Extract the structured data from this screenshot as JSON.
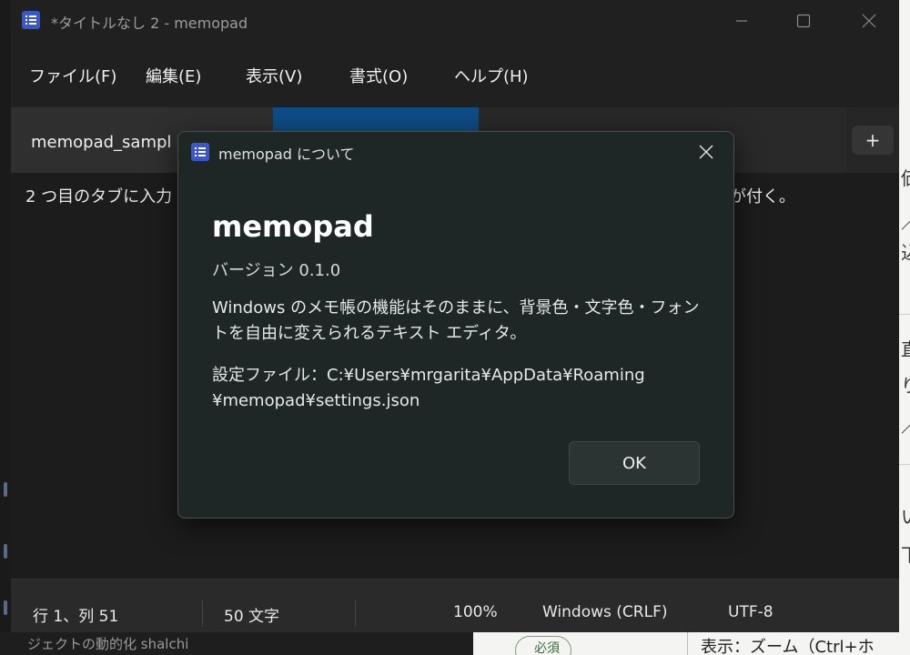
{
  "window": {
    "title": "*タイトルなし 2 - memopad"
  },
  "menu": {
    "file": "ファイル(F)",
    "edit": "編集(E)",
    "view": "表示(V)",
    "format": "書式(O)",
    "help": "ヘルプ(H)"
  },
  "tabs": {
    "active_label": "memopad_sampl",
    "add_label": "+"
  },
  "editor": {
    "text_start": "2 つ目のタブに入力",
    "text_end": "が付く。"
  },
  "status": {
    "position": "行 1、列 51",
    "chars": "50 文字",
    "zoom": "100%",
    "line_ending": "Windows (CRLF)",
    "encoding": "UTF-8"
  },
  "dialog": {
    "title": "memopad について",
    "app_name": "memopad",
    "version": "バージョン 0.1.0",
    "description": "Windows のメモ帳の機能はそのままに、背景色・文字色・フォントを自由に変えられるテキスト エディタ。",
    "settings_line1": "設定ファイル：C:¥Users¥mrgarita¥AppData¥Roaming",
    "settings_line2": "¥memopad¥settings.json",
    "ok_label": "OK"
  },
  "background": {
    "right_frag_1": "価",
    "right_frag_2": "／",
    "right_frag_3": "込",
    "right_frag_4": "直",
    "right_frag_5": "り",
    "right_frag_6": "／",
    "right_frag_7": "い",
    "right_frag_8": "下",
    "bottom_left": "ジェクトの動的化 shalchi",
    "bottom_pill": "必須",
    "bottom_text": "表示：ズーム（Ctrl+ホ"
  },
  "colors": {
    "accent_blue": "#1f6bb0",
    "dialog_bg": "#1f2626",
    "window_bg": "#202020"
  },
  "icons": {
    "app": "notepad-list-icon",
    "close": "close-icon",
    "minimize": "minimize-icon",
    "maximize": "maximize-icon"
  }
}
